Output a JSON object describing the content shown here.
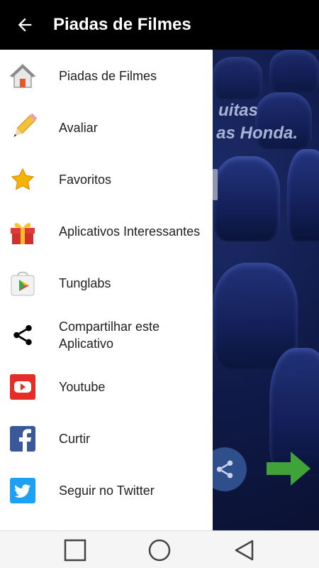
{
  "appbar": {
    "title": "Piadas de Filmes",
    "back_icon": "arrow-left-icon"
  },
  "content": {
    "joke_line1": "uitas",
    "joke_line2": "as Honda."
  },
  "drawer": {
    "items": [
      {
        "label": "Piadas de Filmes",
        "icon": "home-icon"
      },
      {
        "label": "Avaliar",
        "icon": "pencil-icon"
      },
      {
        "label": "Favoritos",
        "icon": "star-icon"
      },
      {
        "label": "Aplicativos Interessantes",
        "icon": "gift-icon"
      },
      {
        "label": "Tunglabs",
        "icon": "play-store-icon"
      },
      {
        "label": "Compartilhar este Aplicativo",
        "icon": "share-icon"
      },
      {
        "label": "Youtube",
        "icon": "youtube-icon"
      },
      {
        "label": "Curtir",
        "icon": "facebook-icon"
      },
      {
        "label": "Seguir no Twitter",
        "icon": "twitter-icon"
      }
    ]
  },
  "colors": {
    "appbar_bg": "#000000",
    "drawer_bg": "#ffffff",
    "navbar_bg": "#f5f5f5",
    "content_bg": "#0f1946"
  },
  "navbar": {
    "buttons": [
      "recents-square-icon",
      "home-circle-icon",
      "back-triangle-icon"
    ]
  }
}
